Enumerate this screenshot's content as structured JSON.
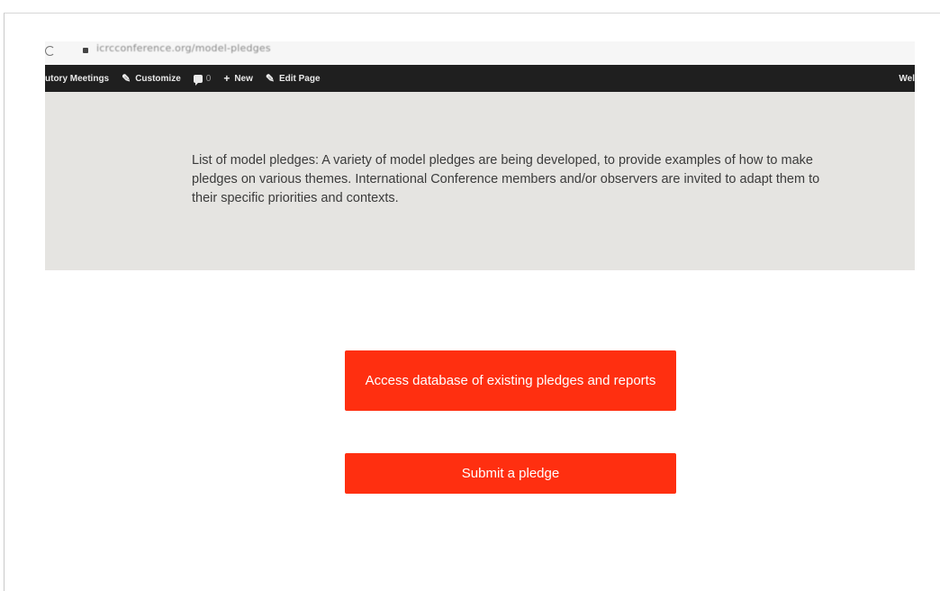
{
  "browser": {
    "url": "icrcconference.org/model-pledges"
  },
  "admin_bar": {
    "items": [
      {
        "label": "utory Meetings",
        "icon": ""
      },
      {
        "label": "Customize",
        "icon": "pencil-icon"
      },
      {
        "label": "0",
        "icon": "comment-icon"
      },
      {
        "label": "New",
        "icon": "plus-icon"
      },
      {
        "label": "Edit Page",
        "icon": "pencil-icon"
      }
    ],
    "right_label": "Wel"
  },
  "banner": {
    "text": "List of model pledges: A variety of model pledges are being developed, to provide examples of how to make pledges on various themes. International Conference members and/or observers are invited to adapt them to their specific priorities and contexts."
  },
  "buttons": {
    "database_label": "Access database of existing pledges and reports",
    "submit_label": "Submit a pledge"
  },
  "colors": {
    "button": "#ff2f10",
    "admin_bar": "#1f1f1f",
    "banner": "#e5e4e1"
  }
}
